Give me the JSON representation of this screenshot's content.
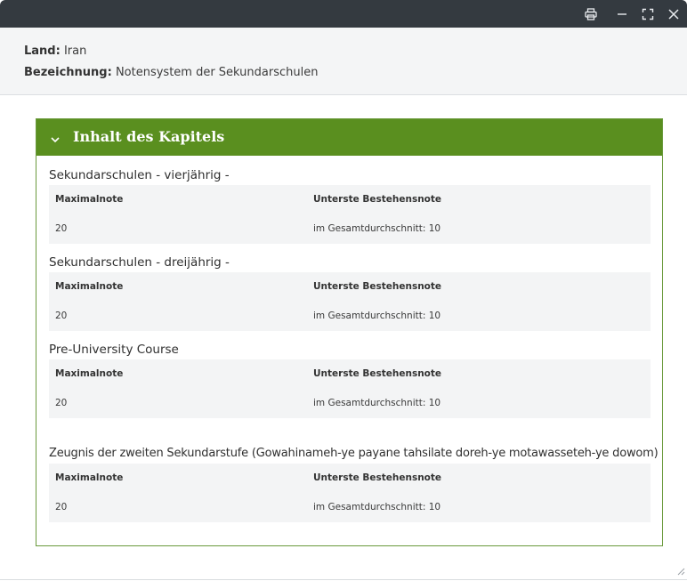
{
  "header": {
    "land_label": "Land:",
    "land_value": "Iran",
    "bezeichnung_label": "Bezeichnung:",
    "bezeichnung_value": "Notensystem der Sekundarschulen"
  },
  "panel": {
    "title": "Inhalt des Kapitels"
  },
  "sections": [
    {
      "title": "Sekundarschulen - vierjährig -",
      "col1_label": "Maximalnote",
      "col2_label": "Unterste Bestehensnote",
      "col1_value": "20",
      "col2_value": "im Gesamtdurchschnitt: 10"
    },
    {
      "title": "Sekundarschulen - dreijährig -",
      "col1_label": "Maximalnote",
      "col2_label": "Unterste Bestehensnote",
      "col1_value": "20",
      "col2_value": "im Gesamtdurchschnitt: 10"
    },
    {
      "title": "Pre-University Course",
      "col1_label": "Maximalnote",
      "col2_label": "Unterste Bestehensnote",
      "col1_value": "20",
      "col2_value": "im Gesamtdurchschnitt: 10"
    },
    {
      "title": "Zeugnis der zweiten Sekundarstufe (Gowahinameh-ye payane tahsilate doreh-ye motawasseteh-ye dowom)",
      "col1_label": "Maximalnote",
      "col2_label": "Unterste Bestehensnote",
      "col1_value": "20",
      "col2_value": "im Gesamtdurchschnitt: 10"
    }
  ],
  "icons": {
    "print": "printer-icon",
    "minimize": "minimize-icon",
    "maximize": "maximize-icon",
    "close": "close-icon",
    "collapse": "chevron-down-icon",
    "resize": "resize-handle-icon"
  },
  "colors": {
    "titlebar": "#343a40",
    "panel_header": "#5a8f1f",
    "panel_border": "#6a9a3c",
    "header_bg": "#f4f5f6",
    "grade_box_bg": "#f3f4f5"
  }
}
